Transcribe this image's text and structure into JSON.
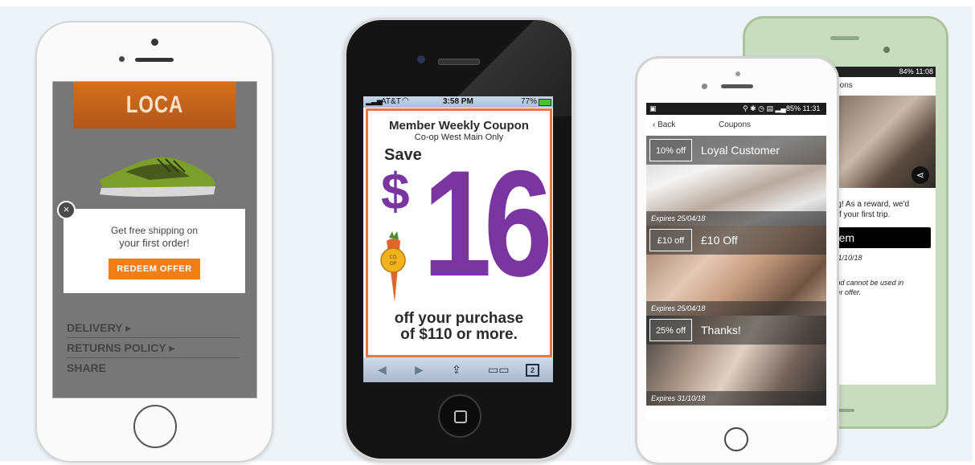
{
  "phone1": {
    "brand": "LOCA",
    "popup_line1": "Get free shipping on",
    "popup_line2": "your first order!",
    "close_glyph": "×",
    "redeem_label": "REDEEM OFFER",
    "menu": [
      {
        "label": "DELIVERY ▸"
      },
      {
        "label": "RETURNS POLICY ▸"
      },
      {
        "label": "SHARE"
      }
    ]
  },
  "phone2": {
    "carrier": "AT&T",
    "time": "3:58 PM",
    "battery": "77%",
    "coupon_title": "Member Weekly Coupon",
    "coupon_subtitle": "Co-op West Main Only",
    "save_label": "Save",
    "currency": "$",
    "amount": "16",
    "coop_logo_text": "CO OP",
    "offer_line1": "off your purchase",
    "offer_line2": "of $110 or more.",
    "tabs_count": "2",
    "colors": {
      "purple": "#7a35a0",
      "border": "#e07a45"
    }
  },
  "phone3": {
    "status": "85% 11:31",
    "back_label": "‹ Back",
    "nav_title": "Coupons",
    "coupons": [
      {
        "badge": "10% off",
        "title": "Loyal Customer",
        "expires": "Expires 25/04/18"
      },
      {
        "badge": "£10 off",
        "title": "£10 Off",
        "expires": "Expires 25/04/18"
      },
      {
        "badge": "25% off",
        "title": "Thanks!",
        "expires": "Expires 31/10/18"
      }
    ]
  },
  "phone4": {
    "status": "84% 11:08",
    "nav_title": "oupons",
    "text_line1": "ding! As a reward, we'd",
    "text_line2": "s off your first trip.",
    "redeem_label": "deem",
    "expires": "s: 31/10/18",
    "terms_line1": "e and cannot be used in",
    "terms_line2": "other offer."
  }
}
